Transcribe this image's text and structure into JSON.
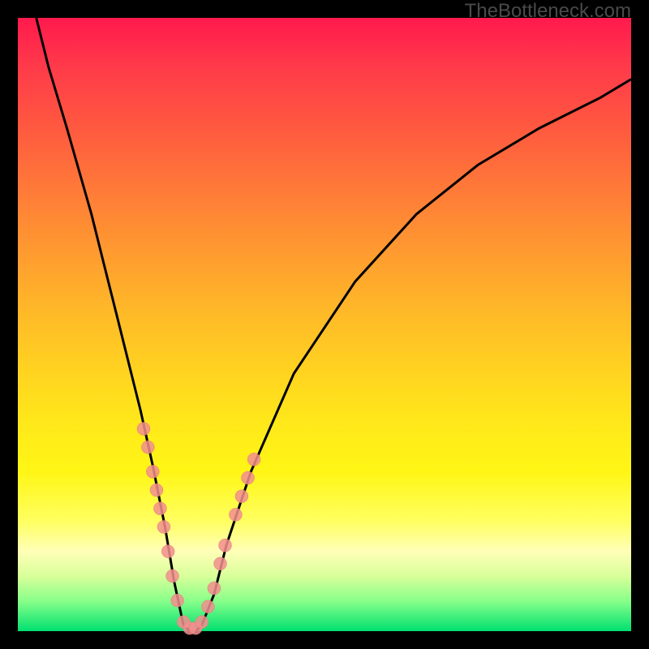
{
  "watermark": "TheBottleneck.com",
  "colors": {
    "gradient_top": "#ff1a4d",
    "gradient_bottom": "#00e070",
    "curve": "#000000",
    "dots": "#f28e8e",
    "frame": "#000000"
  },
  "chart_data": {
    "type": "line",
    "title": "",
    "xlabel": "",
    "ylabel": "",
    "xlim": [
      0,
      100
    ],
    "ylim": [
      0,
      100
    ],
    "series": [
      {
        "name": "bottleneck-curve",
        "x": [
          3,
          5,
          8,
          10,
          12,
          14,
          16,
          18,
          20,
          22,
          24,
          25.5,
          27,
          28,
          29,
          30,
          32,
          34,
          38,
          45,
          55,
          65,
          75,
          85,
          95,
          100
        ],
        "y": [
          100,
          92,
          82,
          75,
          68,
          60,
          52,
          44,
          36,
          27,
          17,
          8,
          1,
          0,
          0,
          1,
          6,
          14,
          26,
          42,
          57,
          68,
          76,
          82,
          87,
          90
        ]
      }
    ],
    "markers": [
      {
        "x": 20.5,
        "y": 33
      },
      {
        "x": 21.2,
        "y": 30
      },
      {
        "x": 22.0,
        "y": 26
      },
      {
        "x": 22.6,
        "y": 23
      },
      {
        "x": 23.2,
        "y": 20
      },
      {
        "x": 23.8,
        "y": 17
      },
      {
        "x": 24.5,
        "y": 13
      },
      {
        "x": 25.2,
        "y": 9
      },
      {
        "x": 26.0,
        "y": 5
      },
      {
        "x": 27.0,
        "y": 1.5
      },
      {
        "x": 28.0,
        "y": 0.5
      },
      {
        "x": 29.0,
        "y": 0.5
      },
      {
        "x": 30.0,
        "y": 1.5
      },
      {
        "x": 31.0,
        "y": 4
      },
      {
        "x": 32.0,
        "y": 7
      },
      {
        "x": 33.0,
        "y": 11
      },
      {
        "x": 33.8,
        "y": 14
      },
      {
        "x": 35.5,
        "y": 19
      },
      {
        "x": 36.5,
        "y": 22
      },
      {
        "x": 37.5,
        "y": 25
      },
      {
        "x": 38.5,
        "y": 28
      }
    ]
  }
}
